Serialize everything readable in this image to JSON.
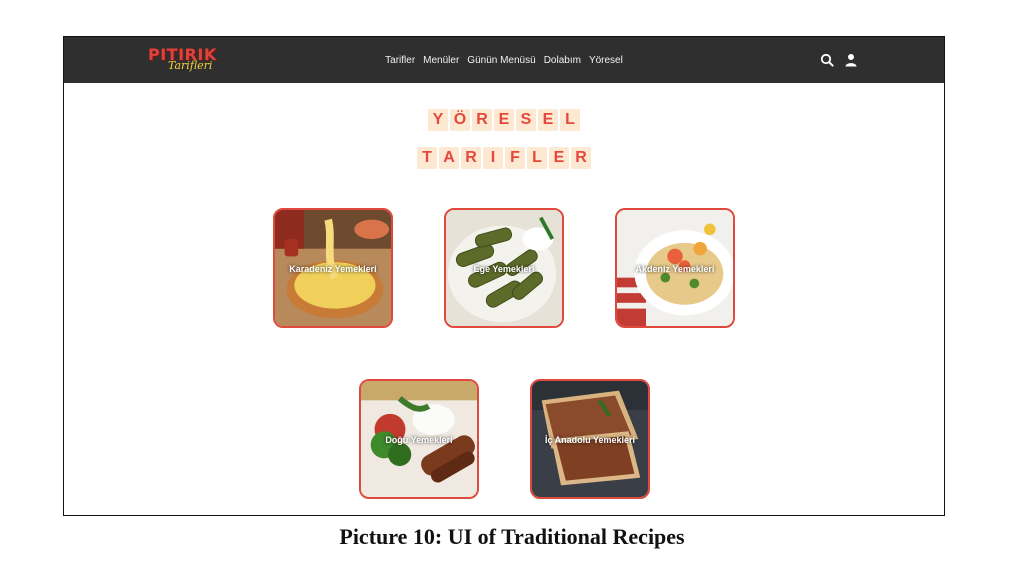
{
  "logo": {
    "main": "PITIRIK",
    "sub": "Tarifleri"
  },
  "nav": {
    "items": [
      "Tarifler",
      "Menüler",
      "Günün Menüsü",
      "Dolabım",
      "Yöresel"
    ]
  },
  "icons": {
    "search": "search-icon",
    "user": "user-icon"
  },
  "title": {
    "line1": [
      "Y",
      "Ö",
      "R",
      "E",
      "S",
      "E",
      "L"
    ],
    "line2": [
      "T",
      "A",
      "R",
      "I",
      "F",
      "L",
      "E",
      "R"
    ]
  },
  "cards": [
    {
      "label": "Karadeniz Yemekleri"
    },
    {
      "label": "Ege Yemekleri"
    },
    {
      "label": "Akdeniz Yemekleri"
    },
    {
      "label": "Doğu Yemekleri"
    },
    {
      "label": "İç Anadolu Yemekleri"
    }
  ],
  "caption": "Picture 10: UI of Traditional Recipes",
  "colors": {
    "accent": "#e0493d",
    "topbar": "#2f2f2f",
    "letter_bg": "#fde8d2"
  }
}
